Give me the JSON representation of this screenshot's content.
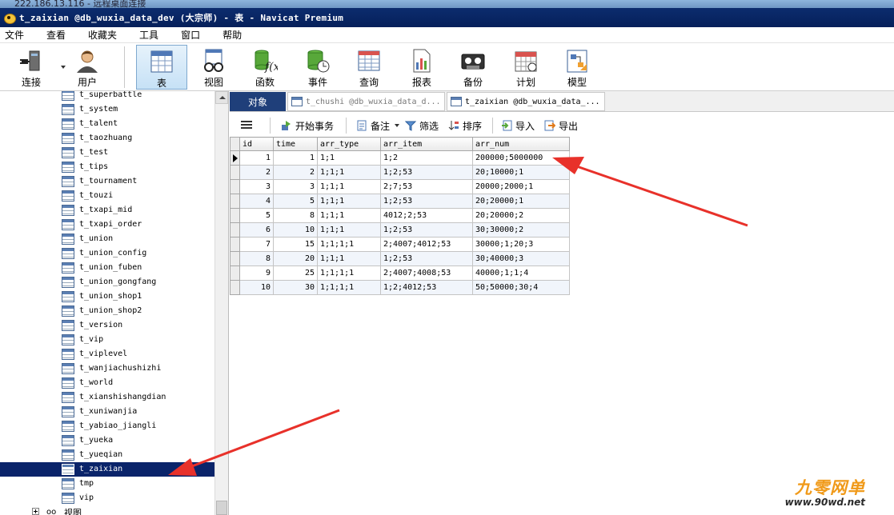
{
  "outer_window": {
    "title": "222.186.13.116 - 远程桌面连接"
  },
  "window": {
    "title": "t_zaixian @db_wuxia_data_dev (大宗师) - 表 - Navicat Premium"
  },
  "menu": [
    "文件",
    "查看",
    "收藏夹",
    "工具",
    "窗口",
    "帮助"
  ],
  "toolbar": {
    "connect": "连接",
    "user": "用户",
    "table": "表",
    "view": "视图",
    "function": "函数",
    "event": "事件",
    "query": "查询",
    "report": "报表",
    "backup": "备份",
    "schedule": "计划",
    "model": "模型"
  },
  "sidebar": {
    "tables": [
      "t_superbattle",
      "t_system",
      "t_talent",
      "t_taozhuang",
      "t_test",
      "t_tips",
      "t_tournament",
      "t_touzi",
      "t_txapi_mid",
      "t_txapi_order",
      "t_union",
      "t_union_config",
      "t_union_fuben",
      "t_union_gongfang",
      "t_union_shop1",
      "t_union_shop2",
      "t_version",
      "t_vip",
      "t_viplevel",
      "t_wanjiachushizhi",
      "t_world",
      "t_xianshishangdian",
      "t_xuniwanjia",
      "t_yabiao_jiangli",
      "t_yueka",
      "t_yueqian",
      "t_zaixian",
      "tmp",
      "vip"
    ],
    "selected": "t_zaixian",
    "views_node": "视图"
  },
  "tabs": {
    "objects": "对象",
    "tab1": "t_chushi @db_wuxia_data_d...",
    "tab2": "t_zaixian @db_wuxia_data_..."
  },
  "object_toolbar": {
    "begin_transaction": "开始事务",
    "memo": "备注",
    "filter": "筛选",
    "sort": "排序",
    "import": "导入",
    "export": "导出"
  },
  "grid": {
    "columns": [
      "id",
      "time",
      "arr_type",
      "arr_item",
      "arr_num"
    ],
    "rows": [
      [
        "1",
        "1",
        "1;1",
        "1;2",
        "200000;5000000"
      ],
      [
        "2",
        "2",
        "1;1;1",
        "1;2;53",
        "20;10000;1"
      ],
      [
        "3",
        "3",
        "1;1;1",
        "2;7;53",
        "20000;2000;1"
      ],
      [
        "4",
        "5",
        "1;1;1",
        "1;2;53",
        "20;20000;1"
      ],
      [
        "5",
        "8",
        "1;1;1",
        "4012;2;53",
        "20;20000;2"
      ],
      [
        "6",
        "10",
        "1;1;1",
        "1;2;53",
        "30;30000;2"
      ],
      [
        "7",
        "15",
        "1;1;1;1",
        "2;4007;4012;53",
        "30000;1;20;3"
      ],
      [
        "8",
        "20",
        "1;1;1",
        "1;2;53",
        "30;40000;3"
      ],
      [
        "9",
        "25",
        "1;1;1;1",
        "2;4007;4008;53",
        "40000;1;1;4"
      ],
      [
        "10",
        "30",
        "1;1;1;1",
        "1;2;4012;53",
        "50;50000;30;4"
      ]
    ]
  },
  "watermark": {
    "title": "九零网单",
    "url": "www.90wd.net"
  },
  "colors": {
    "annotation_arrow": "#e8312a",
    "selection": "#0a246a",
    "title_bar": "#0c2c6e"
  }
}
